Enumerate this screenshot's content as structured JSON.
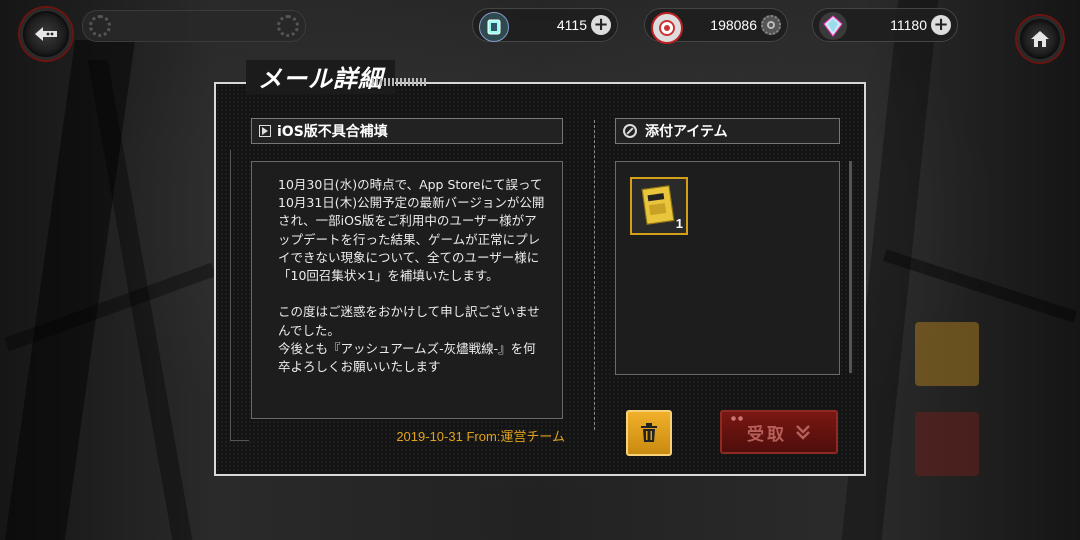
{
  "currencies": [
    {
      "icon": "crystal-card-icon",
      "value": "4115",
      "action": "+"
    },
    {
      "icon": "medal-icon",
      "value": "198086",
      "action": "gear"
    },
    {
      "icon": "diamond-icon",
      "value": "11180",
      "action": "+"
    }
  ],
  "panel": {
    "title": "メール詳細"
  },
  "mail": {
    "subject": "iOS版不具合補填",
    "body": "10月30日(水)の時点で、App Storeにて誤って10月31日(木)公開予定の最新バージョンが公開され、一部iOS版をご利用中のユーザー様がアップデートを行った結果、ゲームが正常にプレイできない現象について、全てのユーザー様に「10回召集状×1」を補填いたします。\n\nこの度はご迷惑をおかけして申し訳ございませんでした。\n今後とも『アッシュアームズ-灰燼戦線-』を何卒よろしくお願いいたします",
    "footer": "2019-10-31  From:運営チーム"
  },
  "attachments": {
    "header": "添付アイテム",
    "items": [
      {
        "icon": "summon-ticket-icon",
        "count": "1"
      }
    ]
  },
  "actions": {
    "receive_label": "受取"
  },
  "colors": {
    "accent_gold": "#e0a21c",
    "receive_red": "#7a1713",
    "panel_border": "#d8d8d8"
  }
}
